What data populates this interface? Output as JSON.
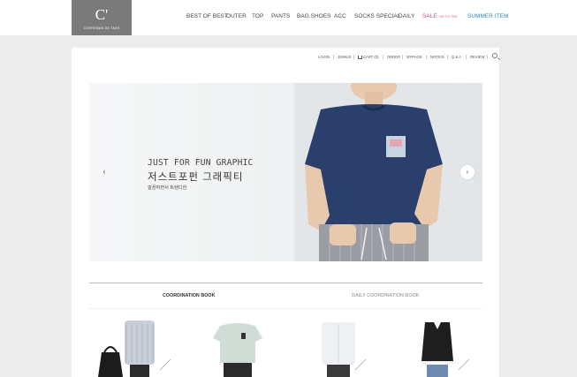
{
  "logo": {
    "mark": "C'",
    "tagline": "CORREMAN DE TASS"
  },
  "main_nav": {
    "items": [
      "BEST OF BEST",
      "OUTER",
      "TOP",
      "PANTS",
      "BAG.SHOES",
      "ACC",
      "SOCKS SPECIAL",
      "DAILY"
    ],
    "sale_label": "SALE",
    "sale_note": "~UP TO 70%",
    "summer_label": "SUMMER ITEM"
  },
  "util_nav": {
    "items": [
      "LOGIN",
      "JOINUS",
      "CART (0)",
      "ORDER",
      "MYPAGE",
      "NOTICE",
      "Q & A",
      "REVIEW"
    ]
  },
  "banner": {
    "title": "JUST FOR FUN GRAPHIC",
    "korean_title": "저스트포펀 그래픽티",
    "subtitle": "깔끔하면서 트렌디한",
    "prev_arrow": "‹",
    "next_arrow": "›"
  },
  "tabs": {
    "coordination": "COORDINATION BOOK",
    "daily": "DAILY COORDINATION BOOK"
  },
  "colors": {
    "logo_bg": "#7a7a7a",
    "sale": "#e0457b",
    "summer": "#2a86c8",
    "tshirt": "#2a3f6b"
  }
}
